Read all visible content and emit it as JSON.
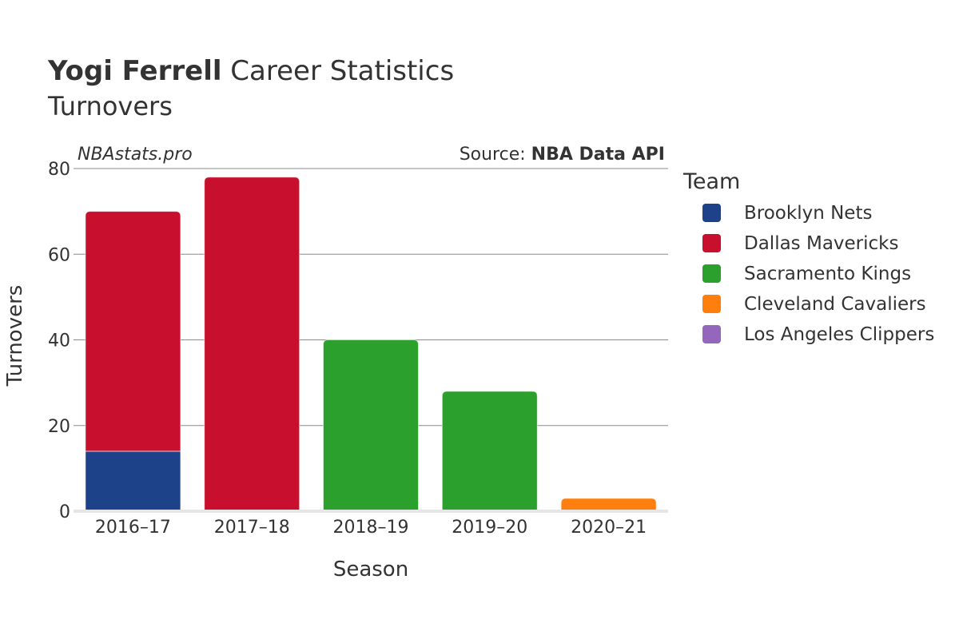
{
  "chart_data": {
    "type": "bar",
    "stacked": true,
    "title_bold": "Yogi Ferrell",
    "title_rest": " Career Statistics",
    "subtitle": "Turnovers",
    "watermark": "NBAstats.pro",
    "source_prefix": "Source: ",
    "source_name": "NBA Data API",
    "xlabel": "Season",
    "ylabel": "Turnovers",
    "ylim": [
      0,
      80
    ],
    "yticks": [
      0,
      20,
      40,
      60,
      80
    ],
    "grid": true,
    "legend_title": "Team",
    "legend_placement": "right",
    "categories": [
      "2016–17",
      "2017–18",
      "2018–19",
      "2019–20",
      "2020–21"
    ],
    "series": [
      {
        "name": "Brooklyn Nets",
        "color": "#1d428a",
        "values": [
          14,
          0,
          0,
          0,
          0
        ]
      },
      {
        "name": "Dallas Mavericks",
        "color": "#c8102e",
        "values": [
          56,
          78,
          0,
          0,
          0
        ]
      },
      {
        "name": "Sacramento Kings",
        "color": "#2ca02c",
        "values": [
          0,
          0,
          40,
          28,
          0
        ]
      },
      {
        "name": "Cleveland Cavaliers",
        "color": "#ff7f0e",
        "values": [
          0,
          0,
          0,
          0,
          3
        ]
      },
      {
        "name": "Los Angeles Clippers",
        "color": "#9467bd",
        "values": [
          0,
          0,
          0,
          0,
          0
        ]
      }
    ]
  }
}
